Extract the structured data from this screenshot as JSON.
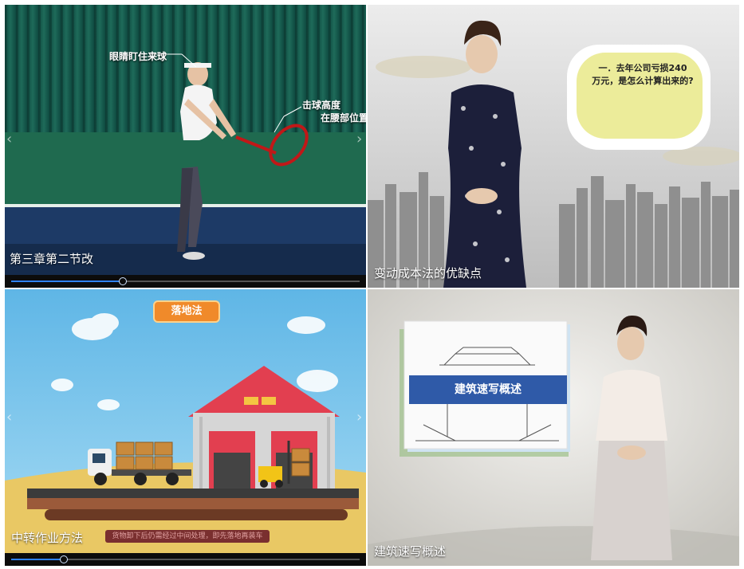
{
  "panels": [
    {
      "caption": "第三章第二节改",
      "annotations": [
        "眼睛盯住来球",
        "击球高度",
        "在腰部位置"
      ],
      "progress": 0.32
    },
    {
      "caption": "变动成本法的优缺点",
      "bubble_lines": [
        "一．去年公司亏损240",
        "万元，是怎么计算出来的?"
      ]
    },
    {
      "caption": "中转作业方法",
      "banner": "落地法",
      "subtitle": "货物卸下后仍需经过中间处理，即先落地再装车",
      "progress": 0.15
    },
    {
      "caption": "建筑速写概述",
      "card_title": "建筑速写概述"
    }
  ],
  "colors": {
    "progress": "#2f82ff",
    "banner": "#f08a2a",
    "card_band": "#2f5aa8",
    "bubble": "#ecec9a"
  },
  "icons": [
    "chevron-left-icon",
    "chevron-right-icon"
  ]
}
